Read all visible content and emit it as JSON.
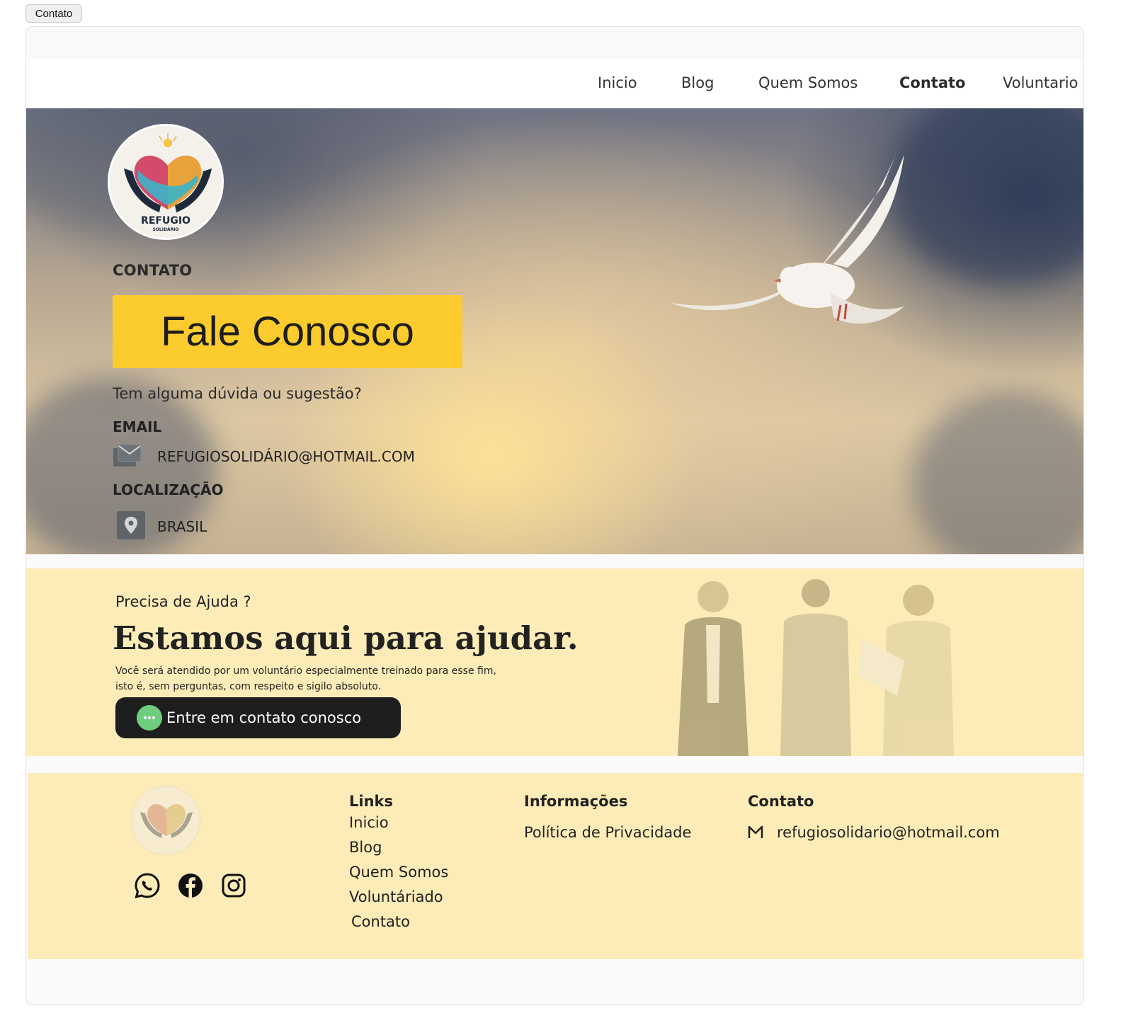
{
  "top_tab": {
    "label": "Contato"
  },
  "nav": {
    "items": [
      {
        "label": "Inicio",
        "active": false
      },
      {
        "label": "Blog",
        "active": false
      },
      {
        "label": "Quem Somos",
        "active": false
      },
      {
        "label": "Contato",
        "active": true
      },
      {
        "label": "Voluntario",
        "active": false
      }
    ]
  },
  "hero": {
    "logo_text": "REFUGIO",
    "logo_subtext": "SOLIDÁRIO",
    "section_label": "CONTATO",
    "title": "Fale Conosco",
    "question": "Tem alguma dúvida ou sugestão?",
    "email_label": "EMAIL",
    "email_value": "REFUGIOSOLIDÁRIO@HOTMAIL.COM",
    "location_label": "LOCALIZAÇÃO",
    "location_value": "BRASIL"
  },
  "help": {
    "pre_title": "Precisa de Ajuda ?",
    "title": "Estamos aqui para ajudar.",
    "description": "Você será atendido por um voluntário especialmente treinado para esse fim, isto é, sem perguntas, com respeito e sigilo absoluto.",
    "button_label": "Entre em contato conosco"
  },
  "footer": {
    "links_title": "Links",
    "links": [
      "Inicio",
      "Blog",
      "Quem Somos",
      "Voluntáriado",
      "Contato"
    ],
    "info_title": "Informações",
    "info_links": [
      "Política de Privacidade"
    ],
    "contact_title": "Contato",
    "contact_email": "refugiosolidario@hotmail.com",
    "social_icons": [
      "whatsapp-icon",
      "facebook-icon",
      "instagram-icon"
    ]
  },
  "colors": {
    "accent_yellow": "#fccb2e",
    "banner_bg": "#fdecb7",
    "button_dark": "#1e1e1e",
    "chat_green": "#6fce7d"
  }
}
